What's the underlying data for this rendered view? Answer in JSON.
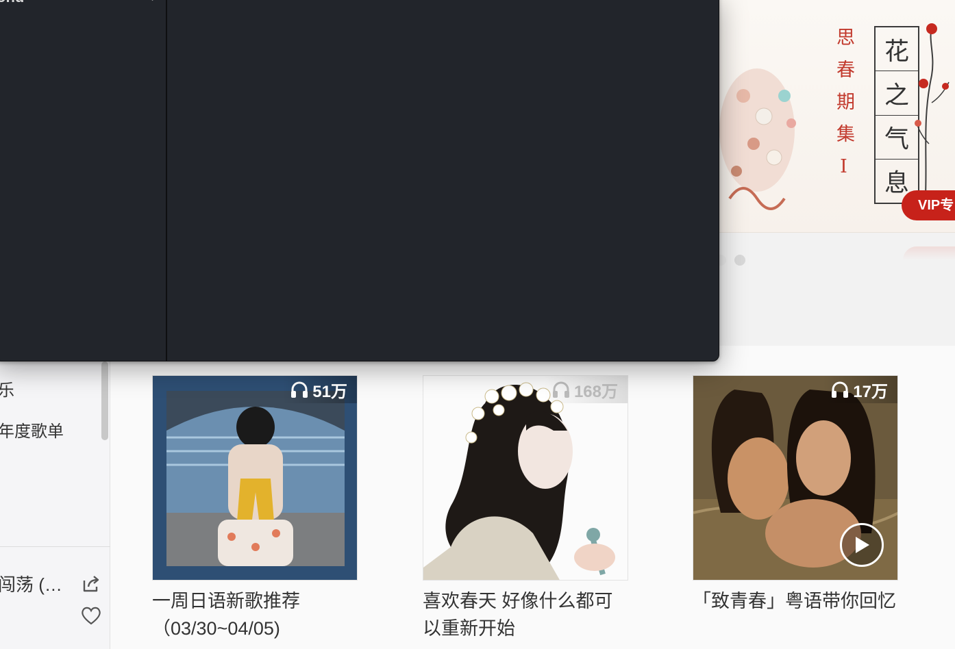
{
  "sidebar": {
    "item_partial_1": "乐",
    "item_partial_2": "年度歌单",
    "now_playing_title": "闯荡 (…"
  },
  "banner": {
    "vertical_text": "思春期集Ⅰ",
    "boxed_chars": [
      "花",
      "之",
      "气",
      "息"
    ],
    "vip_label": "VIP专"
  },
  "playlists": [
    {
      "play_count": "51万",
      "title": "一周日语新歌推荐（03/30~04/05)"
    },
    {
      "play_count": "168万",
      "title": "喜欢春天 好像什么都可以重新开始"
    },
    {
      "play_count": "17万",
      "title": "「致青春」粤语带你回忆"
    }
  ],
  "dark_window": {
    "cut_label": "ond"
  },
  "icons": {
    "share": "share-icon",
    "like": "heart-icon",
    "headphones": "headphones-icon",
    "play": "play-icon"
  }
}
